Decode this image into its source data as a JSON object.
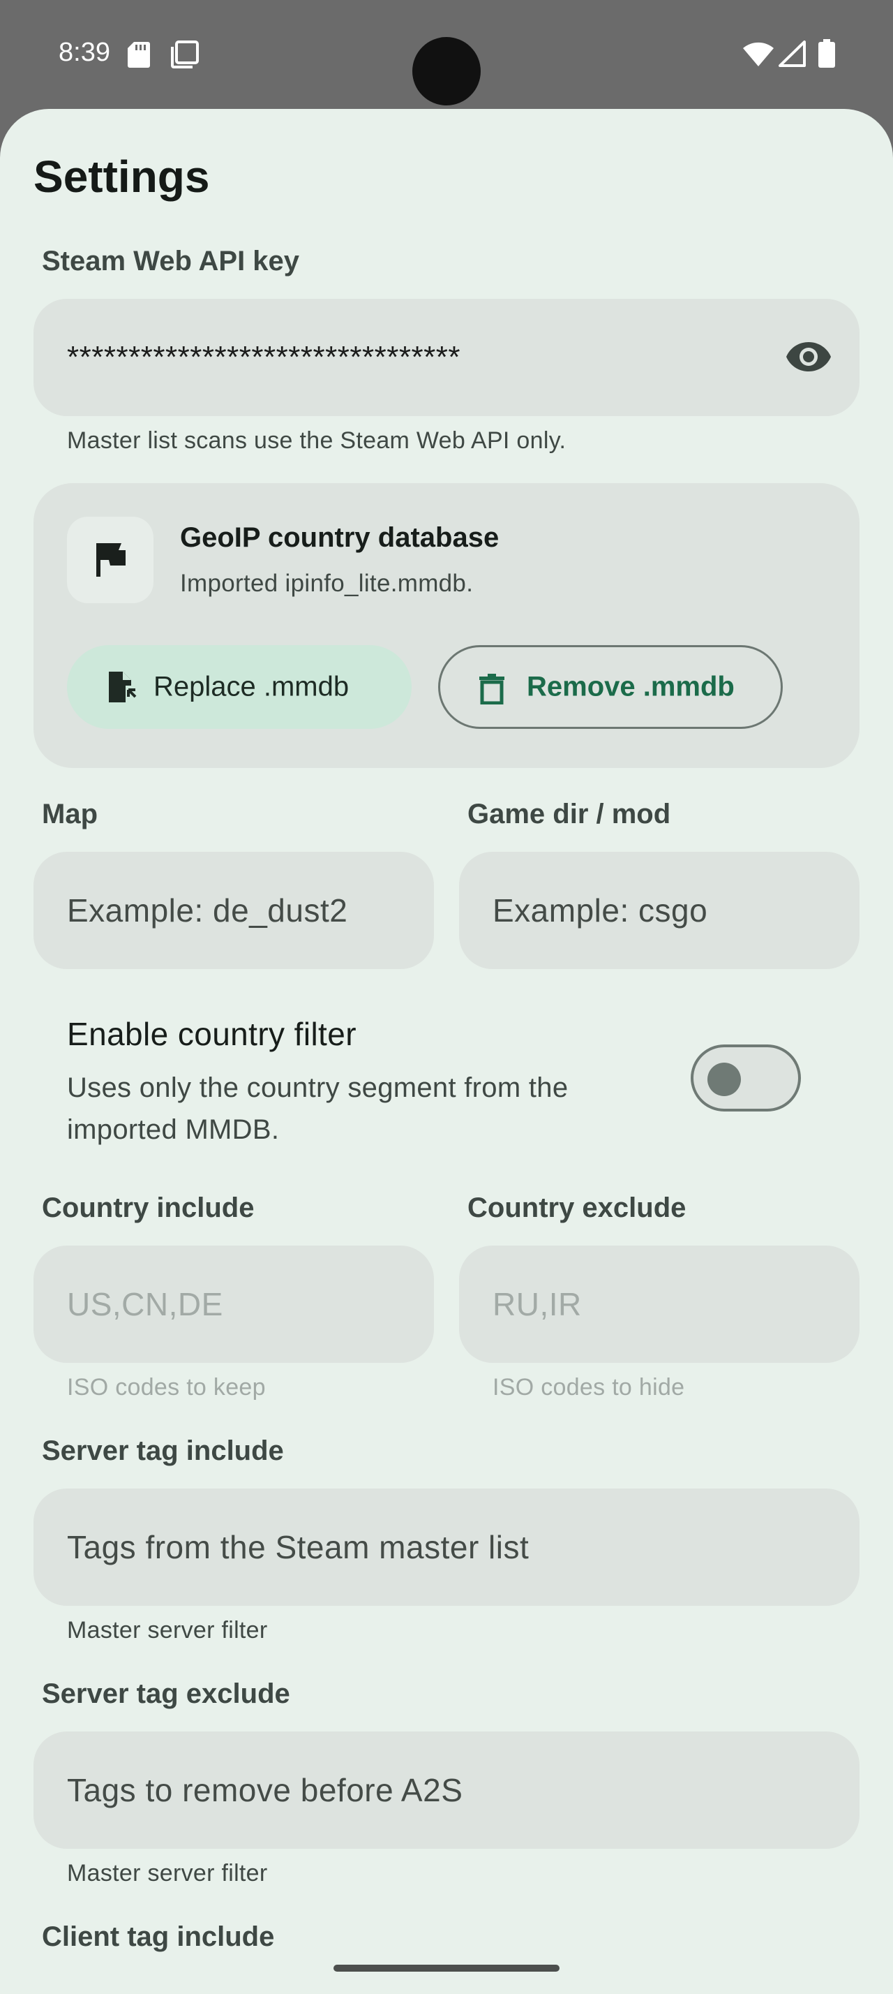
{
  "status_bar": {
    "time": "8:39",
    "icons": [
      "sd-card-icon",
      "screens-icon",
      "wifi-icon",
      "signal-icon",
      "battery-icon"
    ]
  },
  "settings": {
    "title": "Settings",
    "api_key": {
      "label": "Steam Web API key",
      "value": "********************************",
      "helper": "Master list scans use the Steam Web API only.",
      "visibility_icon": "eye-icon"
    },
    "geoip": {
      "title": "GeoIP country database",
      "subtitle": "Imported ipinfo_lite.mmdb.",
      "replace_label": "Replace .mmdb",
      "remove_label": "Remove .mmdb",
      "icon": "flag-icon"
    },
    "map": {
      "label": "Map",
      "placeholder": "Example: de_dust2"
    },
    "game_dir": {
      "label": "Game dir / mod",
      "placeholder": "Example: csgo"
    },
    "country_filter": {
      "title": "Enable country filter",
      "subtitle": "Uses only the country segment from the imported MMDB.",
      "enabled": false
    },
    "country_include": {
      "label": "Country include",
      "placeholder": "US,CN,DE",
      "helper": "ISO codes to keep"
    },
    "country_exclude": {
      "label": "Country exclude",
      "placeholder": "RU,IR",
      "helper": "ISO codes to hide"
    },
    "server_tag_include": {
      "label": "Server tag include",
      "placeholder": "Tags from the Steam master list",
      "helper": "Master server filter"
    },
    "server_tag_exclude": {
      "label": "Server tag exclude",
      "placeholder": "Tags to remove before A2S",
      "helper": "Master server filter"
    },
    "client_tag_include": {
      "label": "Client tag include"
    }
  },
  "colors": {
    "sheet_background": "#e8f1eb",
    "field_background": "#dde3df",
    "accent": "#1b6b4a",
    "tonal_button": "#cde8da"
  }
}
